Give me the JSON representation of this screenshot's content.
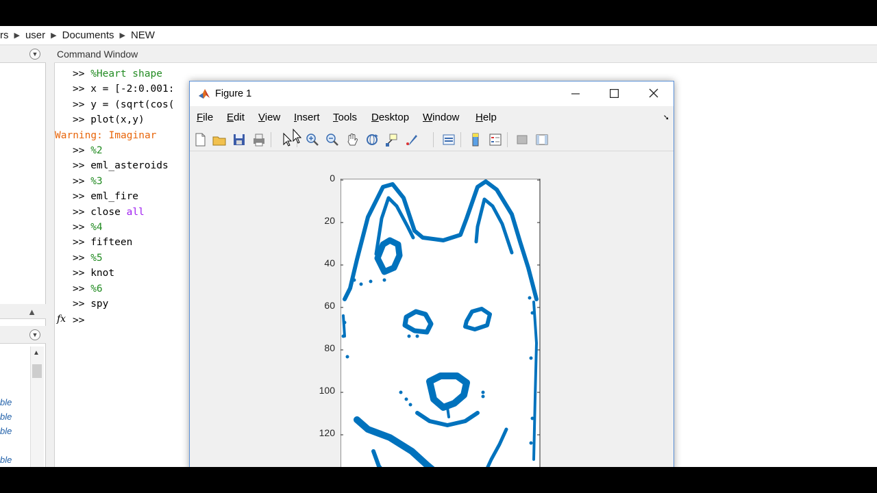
{
  "breadcrumb": {
    "parts": [
      "rs",
      "user",
      "Documents",
      "NEW"
    ]
  },
  "left_panels": {
    "workspace_items": [
      "ble",
      "ble",
      "ble",
      "ble"
    ]
  },
  "command_window": {
    "title": "Command Window",
    "prompt": ">>",
    "fx_symbol": "fx",
    "lines": [
      {
        "kind": "comment",
        "text": "%Heart shape"
      },
      {
        "kind": "code",
        "text": "x = [-2:0.001:"
      },
      {
        "kind": "code",
        "text": "y = (sqrt(cos("
      },
      {
        "kind": "code",
        "text": "plot(x,y)"
      },
      {
        "kind": "warning",
        "text": "Warning: Imaginar"
      },
      {
        "kind": "comment",
        "text": "%2"
      },
      {
        "kind": "code",
        "text": "eml_asteroids"
      },
      {
        "kind": "comment",
        "text": "%3"
      },
      {
        "kind": "code",
        "text": "eml_fire"
      },
      {
        "kind": "code_kw",
        "text": "close ",
        "kw": "all"
      },
      {
        "kind": "comment",
        "text": "%4"
      },
      {
        "kind": "code",
        "text": "fifteen"
      },
      {
        "kind": "comment",
        "text": "%5"
      },
      {
        "kind": "code",
        "text": "knot"
      },
      {
        "kind": "comment",
        "text": "%6"
      },
      {
        "kind": "code",
        "text": "spy"
      }
    ]
  },
  "figure": {
    "title": "Figure 1",
    "menu": [
      {
        "label": "File",
        "u": "F",
        "rest": "ile"
      },
      {
        "label": "Edit",
        "u": "E",
        "rest": "dit"
      },
      {
        "label": "View",
        "u": "V",
        "rest": "iew"
      },
      {
        "label": "Insert",
        "u": "I",
        "rest": "nsert"
      },
      {
        "label": "Tools",
        "u": "T",
        "rest": "ools"
      },
      {
        "label": "Desktop",
        "u": "D",
        "rest": "esktop"
      },
      {
        "label": "Window",
        "u": "W",
        "rest": "indow"
      },
      {
        "label": "Help",
        "u": "H",
        "rest": "elp"
      }
    ],
    "toolbar_icons": [
      "new-figure-icon",
      "open-file-icon",
      "save-icon",
      "print-icon",
      "edit-plot-arrow-icon",
      "zoom-in-icon",
      "zoom-out-icon",
      "pan-hand-icon",
      "rotate-3d-icon",
      "data-cursor-icon",
      "brush-icon",
      "link-plot-icon",
      "colorbar-icon",
      "legend-icon",
      "hide-plot-tools-icon",
      "show-plot-tools-icon"
    ],
    "axes": {
      "yticks": [
        "0",
        "20",
        "40",
        "60",
        "80",
        "100",
        "120"
      ],
      "marker_color": "#0072bd"
    }
  }
}
